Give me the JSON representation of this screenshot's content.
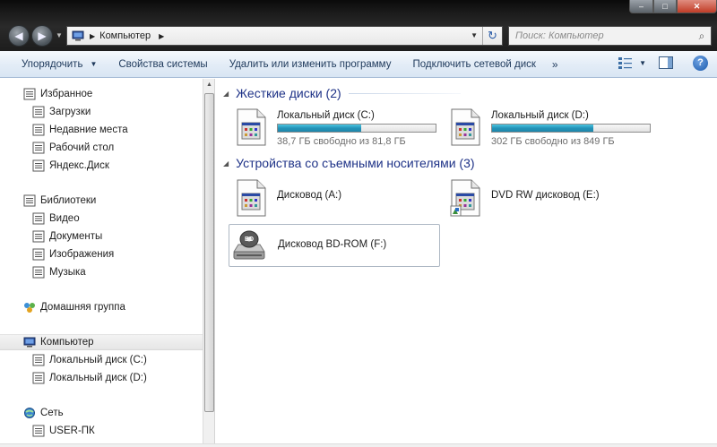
{
  "window": {
    "controls": {
      "minimize": "–",
      "maximize": "□",
      "close": "✕"
    }
  },
  "nav": {
    "back": "◀",
    "forward": "▶",
    "recent": "▼"
  },
  "address": {
    "separator": "▶",
    "crumbs": [
      "Компьютер"
    ],
    "dropdown": "▼",
    "refresh": "↻"
  },
  "search": {
    "placeholder": "Поиск: Компьютер",
    "icon": "⌕"
  },
  "toolbar": {
    "organize": "Упорядочить",
    "system_properties": "Свойства системы",
    "uninstall": "Удалить или изменить программу",
    "map_drive": "Подключить сетевой диск",
    "more": "»",
    "help": "?"
  },
  "sidebar": {
    "favorites": {
      "label": "Избранное",
      "items": [
        "Загрузки",
        "Недавние места",
        "Рабочий стол",
        "Яндекс.Диск"
      ]
    },
    "libraries": {
      "label": "Библиотеки",
      "items": [
        "Видео",
        "Документы",
        "Изображения",
        "Музыка"
      ]
    },
    "homegroup": {
      "label": "Домашняя группа"
    },
    "computer": {
      "label": "Компьютер",
      "items": [
        "Локальный диск (C:)",
        "Локальный диск (D:)"
      ]
    },
    "network": {
      "label": "Сеть",
      "items": [
        "USER-ПК"
      ]
    }
  },
  "content": {
    "hard_drives": {
      "header": "Жесткие диски (2)",
      "drives": [
        {
          "name": "Локальный диск (C:)",
          "free_text": "38,7 ГБ свободно из 81,8 ГБ",
          "used_fraction": 0.527
        },
        {
          "name": "Локальный диск (D:)",
          "free_text": "302 ГБ свободно из 849 ГБ",
          "used_fraction": 0.644
        }
      ]
    },
    "removable": {
      "header": "Устройства со съемными носителями (3)",
      "devices": [
        {
          "name": "Дисковод (A:)"
        },
        {
          "name": "DVD RW дисковод (E:)"
        },
        {
          "name": "Дисковод BD-ROM (F:)",
          "badge": "BD"
        }
      ]
    }
  },
  "colors": {
    "accent": "#1e3287",
    "bar": "#2494b8",
    "toolbar_text": "#1e395b"
  }
}
